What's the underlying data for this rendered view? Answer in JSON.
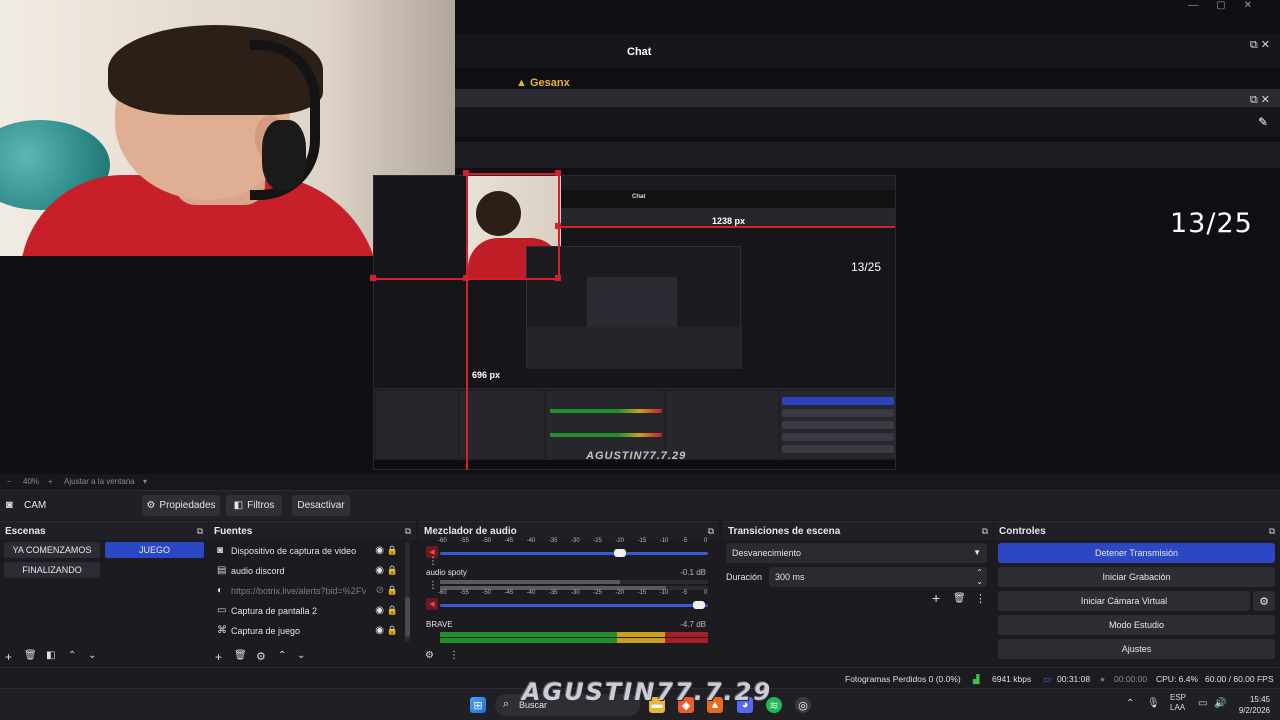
{
  "preview": {
    "chat_title": "Chat",
    "chat_user": "Gesanx",
    "counter": "13/25",
    "nested": {
      "chat_label": "Chat",
      "width_label": "1238 px",
      "counter": "13/25",
      "height_label": "696 px",
      "watermark": "AGUSTIN77.7.29"
    }
  },
  "zoom_bar": {
    "minus": "−",
    "zoom": "40%",
    "plus": "+",
    "fit": "Ajustar a la ventana",
    "dropdown": "▾"
  },
  "source_toolbar": {
    "source_name": "CAM",
    "properties": "Propiedades",
    "filters": "Filtros",
    "deactivate": "Desactivar"
  },
  "scenes": {
    "title": "Escenas",
    "items": [
      "YA COMENZAMOS",
      "JUEGO",
      "FINALIZANDO"
    ],
    "active": "JUEGO"
  },
  "sources": {
    "title": "Fuentes",
    "items": [
      {
        "name": "Dispositivo de captura de video",
        "icon": "camera-icon",
        "visible": true
      },
      {
        "name": "audio discord",
        "icon": "audio-capture-icon",
        "visible": true
      },
      {
        "name": "https://botrix.live/alerts?bid=%2FV",
        "icon": "browser-icon",
        "visible": false
      },
      {
        "name": "Captura de pantalla 2",
        "icon": "monitor-icon",
        "visible": true
      },
      {
        "name": "Captura de juego",
        "icon": "gamepad-icon",
        "visible": true
      }
    ]
  },
  "mixer": {
    "title": "Mezclador de audio",
    "scale": [
      "-60",
      "-55",
      "-50",
      "-45",
      "-40",
      "-35",
      "-30",
      "-25",
      "-20",
      "-15",
      "-10",
      "-5",
      "0"
    ],
    "channels": [
      {
        "name": "",
        "db": ""
      },
      {
        "name": "audio spoty",
        "db": "-0.1 dB"
      },
      {
        "name": "BRAVE",
        "db": "-4.7 dB"
      }
    ]
  },
  "transitions": {
    "title": "Transiciones de escena",
    "selected": "Desvanecimiento",
    "duration_label": "Duración",
    "duration_value": "300 ms"
  },
  "controls": {
    "title": "Controles",
    "stop_stream": "Detener Transmisión",
    "start_record": "Iniciar Grabación",
    "start_vcam": "Iniciar Cámara Virtual",
    "studio_mode": "Modo Estudio",
    "settings": "Ajustes"
  },
  "status": {
    "dropped_frames": "Fotogramas Perdidos 0 (0.0%)",
    "bitrate": "6941 kbps",
    "stream_time": "00:31:08",
    "record_time": "00:00:00",
    "cpu": "CPU: 6.4%",
    "fps": "60.00 / 60.00 FPS"
  },
  "taskbar": {
    "search_placeholder": "Buscar",
    "watermark": "AGUSTIN77.7.29",
    "lang_top": "ESP",
    "lang_bottom": "LAA",
    "time": "15:45",
    "date": "9/2/2026"
  },
  "colors": {
    "accent": "#2b47c4",
    "selection_red": "#d3202a",
    "meter_green": "#1f8f2a",
    "meter_yellow": "#c9a11e",
    "meter_red": "#c0202a"
  }
}
